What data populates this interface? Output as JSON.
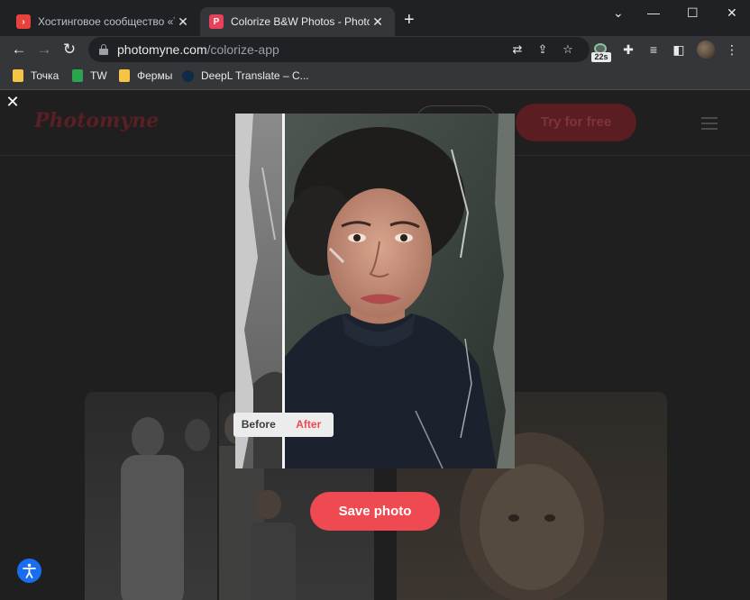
{
  "browser": {
    "tabs": [
      {
        "title": "Хостинговое сообщество «Time",
        "favicon_color": "#e8423b"
      },
      {
        "title": "Colorize B&W Photos - Photomy",
        "favicon_color": "#e8425a",
        "favicon_letter": "P"
      }
    ],
    "address": {
      "host": "photomyne.com",
      "path": "/colorize-app"
    },
    "extension_badge": "22s",
    "bookmarks": [
      {
        "label": "Точка"
      },
      {
        "label": "TW"
      },
      {
        "label": "Фермы"
      },
      {
        "label": "DeepL Translate – C..."
      }
    ]
  },
  "site": {
    "logo": "Photomyne",
    "try_button": "Try for free"
  },
  "modal": {
    "toggle": {
      "before": "Before",
      "after": "After",
      "selected": "after"
    },
    "save_button": "Save photo",
    "accent_color": "#ef4a52"
  }
}
